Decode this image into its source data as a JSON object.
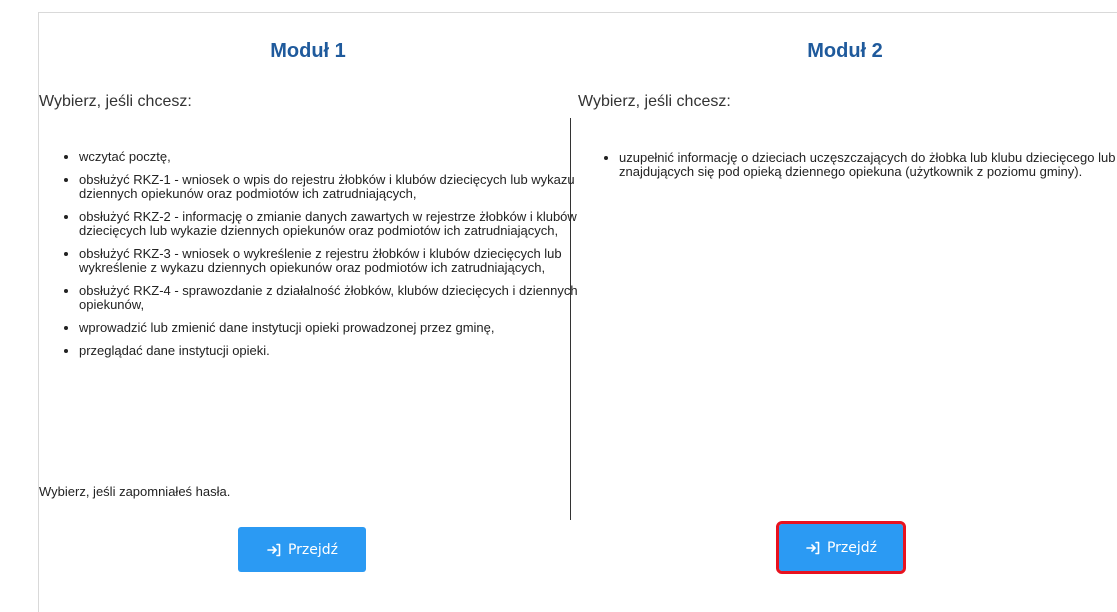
{
  "module1": {
    "title": "Moduł 1",
    "intro": "Wybierz, jeśli chcesz:",
    "items": [
      "wczytać pocztę,",
      "obsłużyć RKZ-1 - wniosek o wpis do rejestru żłobków i klubów dziecięcych lub wykazu dziennych opiekunów oraz podmiotów ich zatrudniających,",
      "obsłużyć RKZ-2 - informację o zmianie danych zawartych w rejestrze żłobków i klubów dziecięcych lub wykazie dziennych opiekunów oraz podmiotów ich zatrudniających,",
      "obsłużyć RKZ-3 - wniosek o wykreślenie z rejestru żłobków i klubów dziecięcych lub wykreślenie z wykazu dziennych opiekunów oraz podmiotów ich zatrudniających,",
      "obsłużyć RKZ-4 - sprawozdanie z działalność żłobków, klubów dziecięcych i dziennych opiekunów,",
      "wprowadzić lub zmienić dane instytucji opieki prowadzonej przez gminę,",
      "przeglądać dane instytucji opieki."
    ],
    "forgot": "Wybierz, jeśli zapomniałeś hasła.",
    "button_label": "Przejdź",
    "button_icon": "login-arrow-icon"
  },
  "module2": {
    "title": "Moduł 2",
    "intro": "Wybierz, jeśli chcesz:",
    "items": [
      "uzupełnić informację o dzieciach uczęszczających do żłobka lub klubu dziecięcego lub znajdujących się pod opieką dziennego opiekuna (użytkownik z poziomu gminy)."
    ],
    "button_label": "Przejdź",
    "button_icon": "login-arrow-icon",
    "button_highlighted": true
  },
  "colors": {
    "title": "#1f5a9c",
    "button": "#2b9af3",
    "highlight": "#e8121f"
  }
}
